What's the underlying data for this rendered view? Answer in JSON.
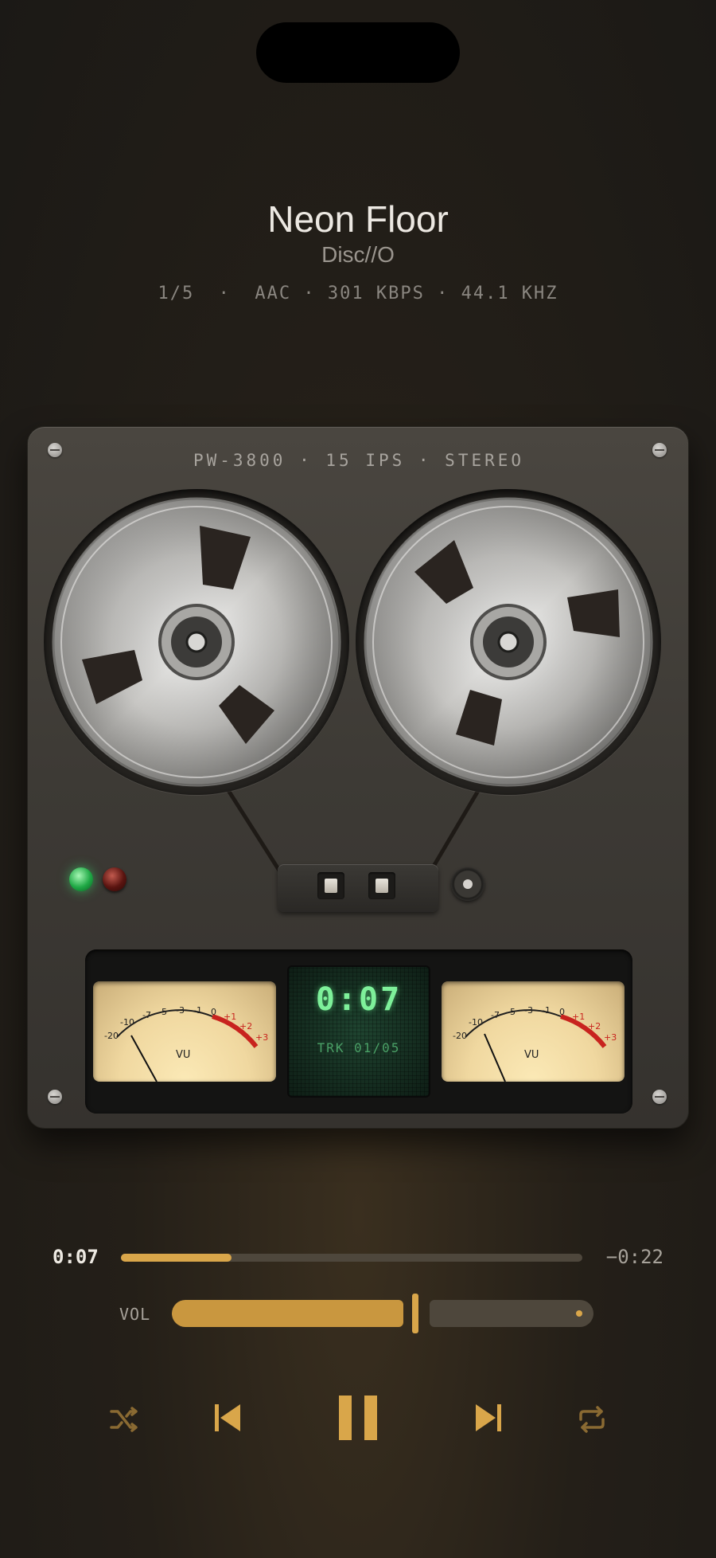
{
  "track": {
    "title": "Neon Floor",
    "artist": "Disc//O",
    "meta": "1/5  ·  AAC · 301 KBPS · 44.1 KHZ"
  },
  "deck": {
    "model_label": "PW-3800 · 15 IPS · STEREO",
    "vu_labels": [
      "-20",
      "-10",
      "-7",
      "-5",
      "-3",
      "-1",
      "0",
      "+1",
      "+2",
      "+3"
    ],
    "vu_unit": "VU",
    "lcd": {
      "time": "0:07",
      "track": "TRK 01/05"
    }
  },
  "playback": {
    "current_time": "0:07",
    "remaining_time": "−0:22",
    "progress_fraction": 0.24
  },
  "volume": {
    "label": "VOL",
    "level_fraction": 0.57
  },
  "controls": {
    "shuffle": "shuffle-icon",
    "previous": "skip-previous-icon",
    "pause": "pause-icon",
    "next": "skip-next-icon",
    "repeat": "repeat-icon"
  },
  "colors": {
    "accent": "#d9a64a",
    "background": "#1b1916",
    "lcd_green": "#7ef09a",
    "vu_red": "#c8231e"
  }
}
